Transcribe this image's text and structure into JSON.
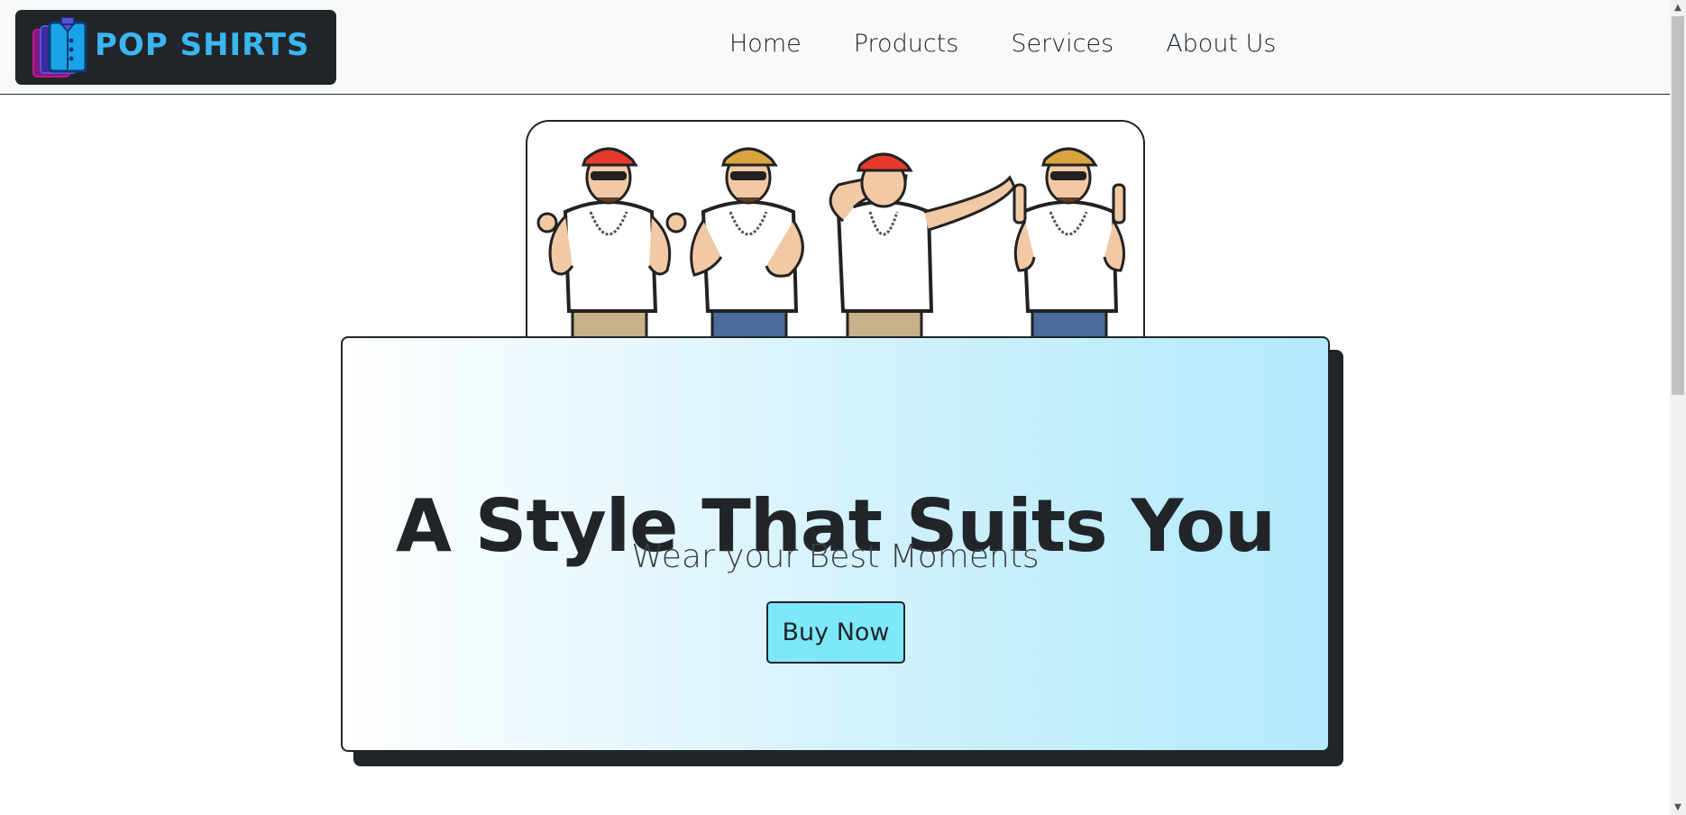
{
  "brand": {
    "name": "POP SHIRTS",
    "icon": "shirt-stack-icon",
    "color": "#3ab6f0"
  },
  "nav": {
    "links": [
      {
        "label": "Home"
      },
      {
        "label": "Products"
      },
      {
        "label": "Services"
      },
      {
        "label": "About Us"
      }
    ]
  },
  "hero": {
    "image": "four-men-dancing-illustration",
    "title": "A Style That Suits You",
    "subtitle": "Wear your Best Moments",
    "button_label": "Buy Now",
    "button_color": "#7ee8fb"
  },
  "colors": {
    "dark": "#212529",
    "gradient_end": "#b3eafc"
  }
}
